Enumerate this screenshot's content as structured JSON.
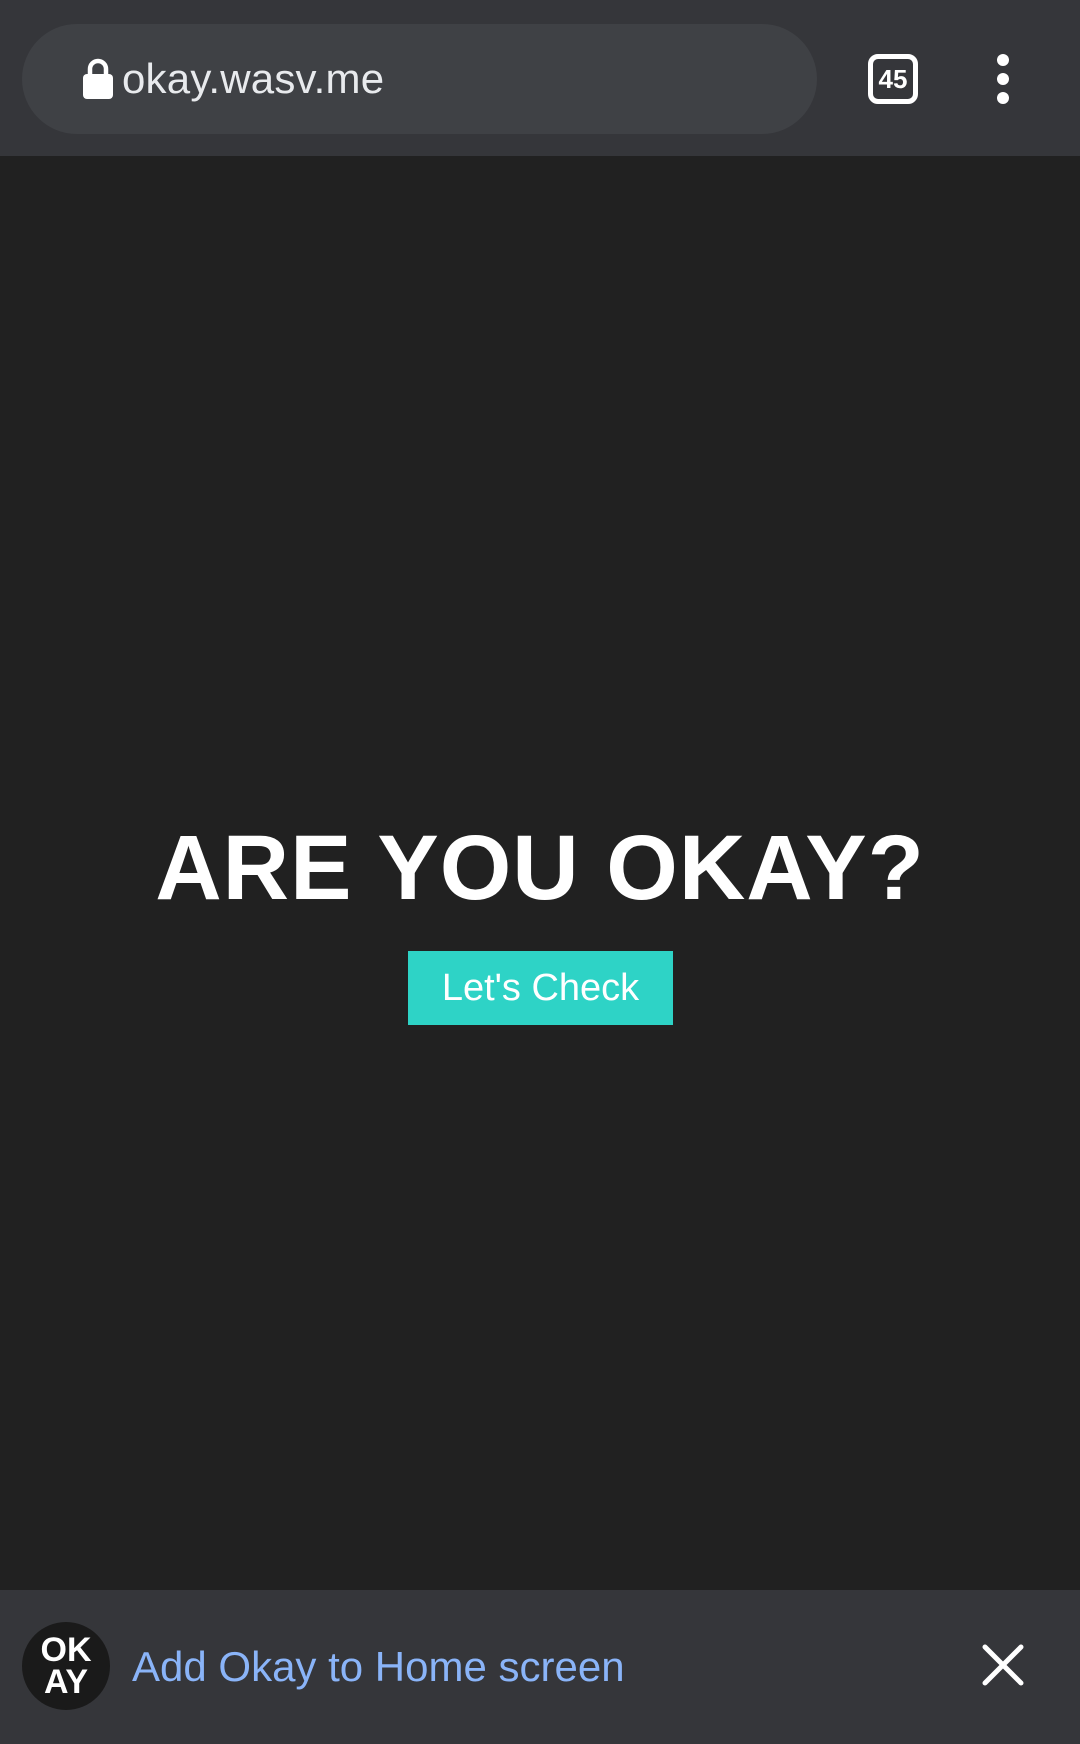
{
  "browser": {
    "url": "okay.wasv.me",
    "tab_count": "45",
    "icons": {
      "lock": "lock-icon",
      "tabs": "tab-switcher-icon",
      "menu": "more-vert-icon"
    }
  },
  "main": {
    "headline": "ARE YOU OKAY?",
    "cta_label": "Let's Check",
    "cta_color": "#2ed3c6",
    "background_color": "#212121"
  },
  "install_banner": {
    "logo_line1": "OK",
    "logo_line2": "AY",
    "text": "Add Okay to Home screen",
    "text_color": "#8ab4f8",
    "close_icon": "close-icon"
  }
}
